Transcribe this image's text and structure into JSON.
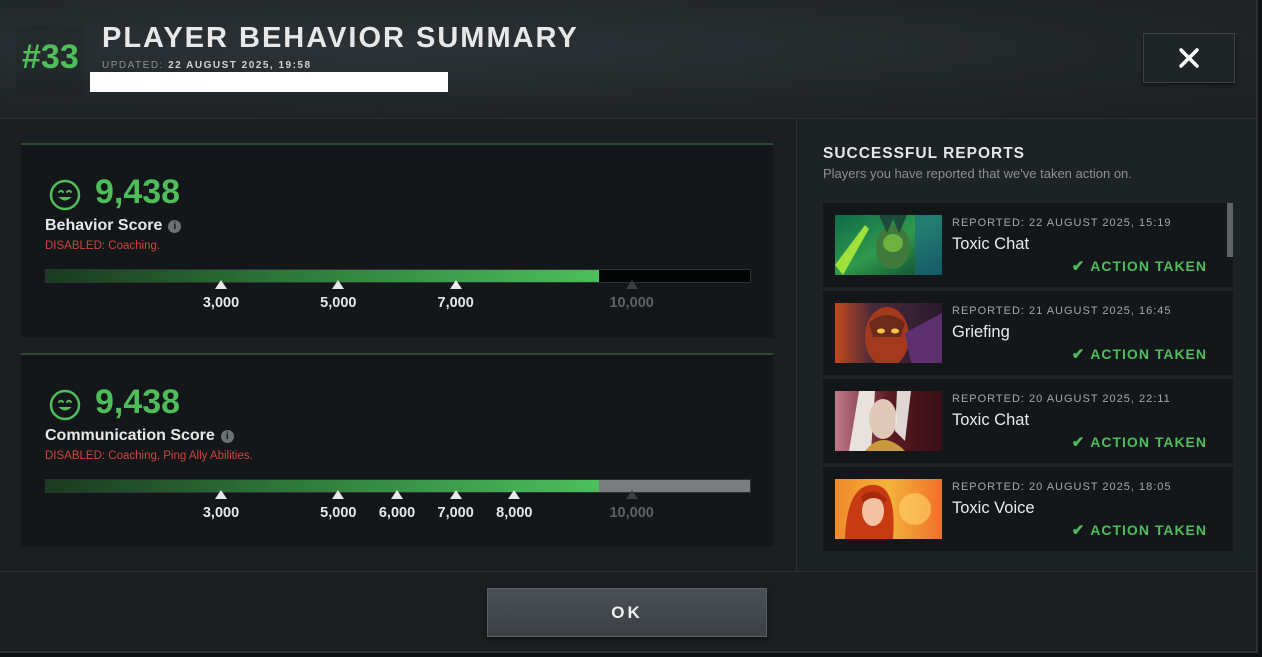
{
  "header": {
    "rank": "#33",
    "title": "PLAYER BEHAVIOR SUMMARY",
    "updated_label": "UPDATED:",
    "updated_value": "22 AUGUST 2025, 19:58",
    "close_icon": "close-icon"
  },
  "behavior": {
    "score": "9,438",
    "label": "Behavior Score",
    "info_glyph": "i",
    "disabled_label": "DISABLED:",
    "disabled_text": "Coaching.",
    "fill_fraction": 0.786,
    "ticks": [
      {
        "value": 3000,
        "label": "3,000"
      },
      {
        "value": 5000,
        "label": "5,000"
      },
      {
        "value": 7000,
        "label": "7,000"
      },
      {
        "value": 10000,
        "label": "10,000",
        "dim": true
      }
    ]
  },
  "communication": {
    "score": "9,438",
    "label": "Communication Score",
    "info_glyph": "i",
    "disabled_label": "DISABLED:",
    "disabled_text": "Coaching, Ping Ally Abilities.",
    "fill_fraction": 0.786,
    "ticks": [
      {
        "value": 3000,
        "label": "3,000"
      },
      {
        "value": 5000,
        "label": "5,000"
      },
      {
        "value": 6000,
        "label": "6,000"
      },
      {
        "value": 7000,
        "label": "7,000"
      },
      {
        "value": 8000,
        "label": "8,000"
      },
      {
        "value": 10000,
        "label": "10,000",
        "dim": true
      }
    ]
  },
  "reports": {
    "title": "SUCCESSFUL REPORTS",
    "subtitle": "Players you have reported that we've taken action on.",
    "items": [
      {
        "date": "REPORTED: 22 AUGUST 2025, 15:19",
        "type": "Toxic Chat",
        "status": "ACTION TAKEN",
        "hero": "green-undead-hero"
      },
      {
        "date": "REPORTED: 21 AUGUST 2025, 16:45",
        "type": "Griefing",
        "status": "ACTION TAKEN",
        "hero": "purple-masked-hero"
      },
      {
        "date": "REPORTED: 20 AUGUST 2025, 22:11",
        "type": "Toxic Chat",
        "status": "ACTION TAKEN",
        "hero": "white-haired-hero"
      },
      {
        "date": "REPORTED: 20 AUGUST 2025, 18:05",
        "type": "Toxic Voice",
        "status": "ACTION TAKEN",
        "hero": "fire-haired-hero"
      }
    ]
  },
  "footer": {
    "ok_label": "OK"
  },
  "colors": {
    "accent_green": "#4fbd5a",
    "disabled_red": "#d0443c"
  }
}
